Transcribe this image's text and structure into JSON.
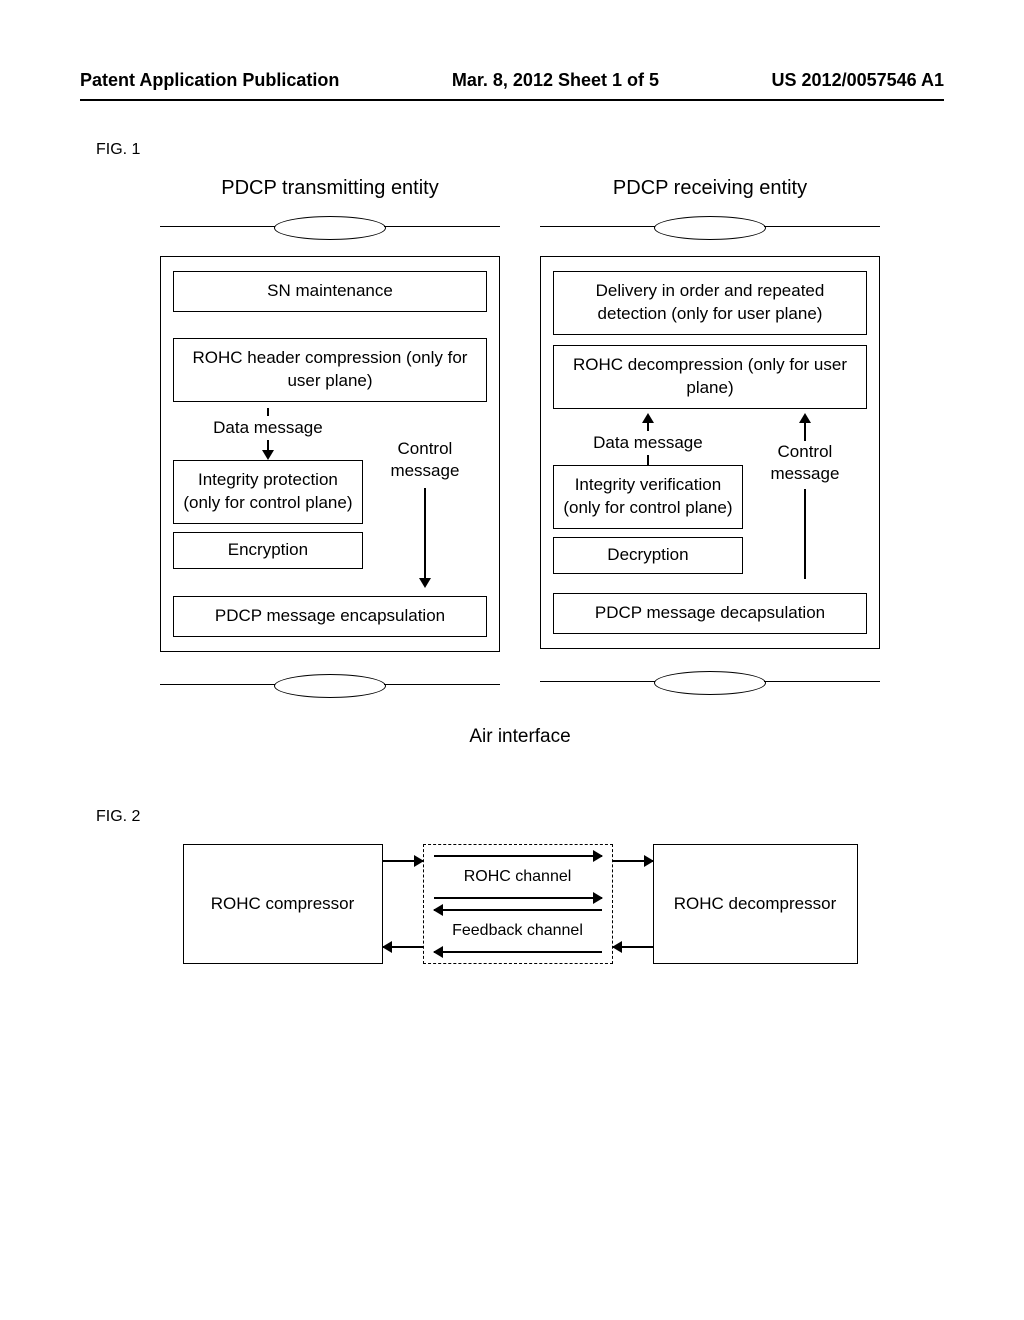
{
  "header": {
    "left": "Patent Application Publication",
    "mid": "Mar. 8, 2012  Sheet 1 of 5",
    "right": "US 2012/0057546 A1"
  },
  "fig1": {
    "label": "FIG. 1",
    "tx_title": "PDCP transmitting entity",
    "rx_title": "PDCP receiving entity",
    "tx": {
      "sn": "SN maintenance",
      "rohc": "ROHC header compression (only for user plane)",
      "data_msg": "Data message",
      "integrity": "Integrity protection (only for control plane)",
      "control_msg": "Control message",
      "encrypt": "Encryption",
      "encap": "PDCP message encapsulation"
    },
    "rx": {
      "deliver": "Delivery in order and repeated detection (only for user plane)",
      "rohc": "ROHC decompression (only for user plane)",
      "data_msg": "Data message",
      "integrity": "Integrity verification (only for control plane)",
      "control_msg": "Control message",
      "decrypt": "Decryption",
      "decap": "PDCP message decapsulation"
    },
    "air": "Air interface"
  },
  "fig2": {
    "label": "FIG. 2",
    "compressor": "ROHC compressor",
    "decompressor": "ROHC decompressor",
    "rohc_channel": "ROHC channel",
    "feedback_channel": "Feedback channel"
  }
}
